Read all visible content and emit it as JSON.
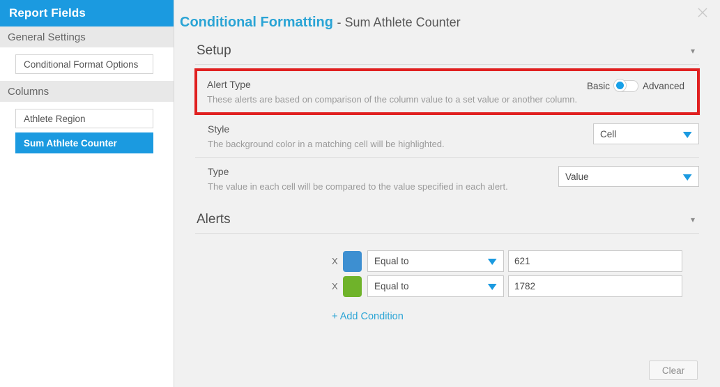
{
  "sidebar": {
    "title": "Report Fields",
    "sections": [
      {
        "heading": "General Settings",
        "items": [
          {
            "label": "Conditional Format Options",
            "selected": false
          }
        ]
      },
      {
        "heading": "Columns",
        "items": [
          {
            "label": "Athlete Region",
            "selected": false
          },
          {
            "label": "Sum Athlete Counter",
            "selected": true
          }
        ]
      }
    ]
  },
  "panel": {
    "title_main": "Conditional Formatting",
    "title_sub": "- Sum Athlete Counter",
    "close_icon": "close-icon",
    "accent_color": "#2aa4d5",
    "highlight_color": "#e02020"
  },
  "setup": {
    "heading": "Setup",
    "collapse_icon": "chevron-down-icon",
    "alert_type": {
      "label": "Alert Type",
      "description": "These alerts are based on comparison of the column value to a set value or another column.",
      "toggle_left": "Basic",
      "toggle_right": "Advanced",
      "selected": "Basic"
    },
    "style": {
      "label": "Style",
      "description": "The background color in a matching cell will be highlighted.",
      "value": "Cell",
      "dropdown_icon": "chevron-down-icon"
    },
    "type": {
      "label": "Type",
      "description": "The value in each cell will be compared to the value specified in each alert.",
      "value": "Value",
      "dropdown_icon": "chevron-down-icon"
    }
  },
  "alerts": {
    "heading": "Alerts",
    "collapse_icon": "chevron-down-icon",
    "remove_label": "X",
    "rows": [
      {
        "color": "#3d8fd1",
        "condition": "Equal to",
        "value": "621"
      },
      {
        "color": "#6fb32a",
        "condition": "Equal to",
        "value": "1782"
      }
    ],
    "add_condition_label": "+ Add Condition"
  },
  "footer": {
    "clear_label": "Clear"
  }
}
